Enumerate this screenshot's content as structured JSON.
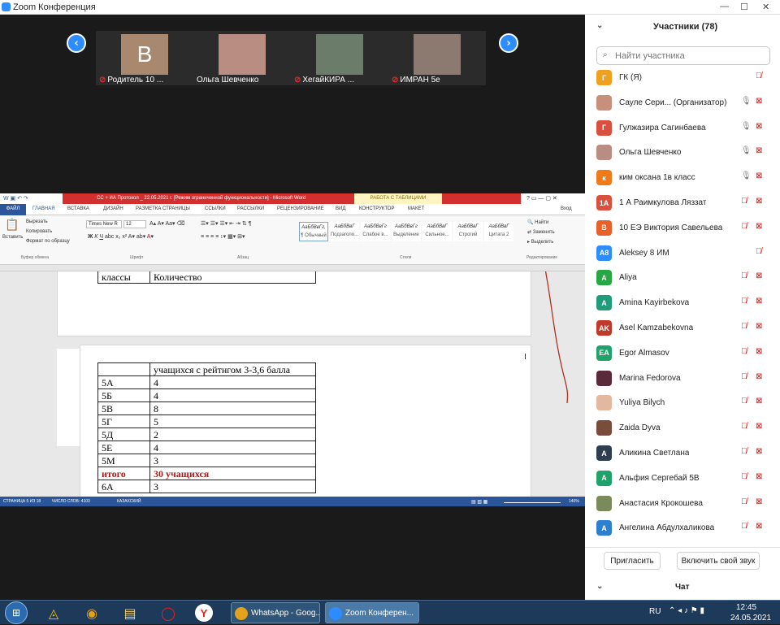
{
  "window": {
    "title": "Zoom Конференция"
  },
  "meeting": {
    "thumbnails": [
      {
        "avatar_letter": "В",
        "avatar_color": "#a8896f",
        "name": "Родитель 10 ...",
        "muted": true
      },
      {
        "avatar_letter": "",
        "avatar_color": "#b98d82",
        "name": "Ольга Шевченко",
        "muted": false
      },
      {
        "avatar_letter": "",
        "avatar_color": "#6b7d6a",
        "name": "ХегайКИРА ...",
        "muted": true
      },
      {
        "avatar_letter": "",
        "avatar_color": "#8c7a70",
        "name": "ИМРАН 5е",
        "muted": true
      }
    ],
    "prev_glyph": "‹",
    "next_glyph": "›"
  },
  "word": {
    "title_text": "СС + ИА Протокол _ 22.05.2021 г. [Режим ограниченной функциональности] - Microsoft Word",
    "context_tab": "РАБОТА С ТАБЛИЦАМИ",
    "signin": "Вход",
    "tabs": [
      "ФАЙЛ",
      "ГЛАВНАЯ",
      "ВСТАВКА",
      "ДИЗАЙН",
      "РАЗМЕТКА СТРАНИЦЫ",
      "ССЫЛКИ",
      "РАССЫЛКИ",
      "РЕЦЕНЗИРОВАНИЕ",
      "ВИД",
      "КОНСТРУКТОР",
      "МАКЕТ"
    ],
    "ribbon": {
      "paste": "Вставить",
      "cut": "Вырезать",
      "copy": "Копировать",
      "format_painter": "Формат по образцу",
      "font_name": "Times New R",
      "font_size": "12",
      "groups": [
        "Буфер обмена",
        "Шрифт",
        "Абзац",
        "Стили",
        "Редактирование"
      ],
      "styles": [
        {
          "sample": "АаБбВвГг,",
          "name": "¶ Обычный"
        },
        {
          "sample": "АаБбВвГ",
          "name": "Подзаголо..."
        },
        {
          "sample": "АаБбВвГг",
          "name": "Слабое в..."
        },
        {
          "sample": "АаБбВвГг",
          "name": "Выделение"
        },
        {
          "sample": "АаБбВвГ",
          "name": "Сильное..."
        },
        {
          "sample": "АаБбВвГ",
          "name": "Строгий"
        },
        {
          "sample": "АаБбВвГ",
          "name": "Цитата 2"
        }
      ],
      "find": "Найти",
      "replace": "Заменить",
      "select": "Выделить"
    },
    "table1": {
      "col1": "классы",
      "col2": "Количество"
    },
    "table2": {
      "header": "учащихся с рейтнгом 3-3,6 балла",
      "rows": [
        {
          "cls": "5А",
          "count": "4"
        },
        {
          "cls": "5Б",
          "count": "4"
        },
        {
          "cls": "5В",
          "count": "8"
        },
        {
          "cls": "5Г",
          "count": "5"
        },
        {
          "cls": "5Д",
          "count": "2"
        },
        {
          "cls": "5Е",
          "count": "4"
        },
        {
          "cls": "5М",
          "count": "3"
        }
      ],
      "total_label": "итого",
      "total_value": "30 учащихся",
      "extra_cls": "6А",
      "extra_count": "3"
    },
    "status": {
      "page": "СТРАНИЦА 5 ИЗ 18",
      "words": "ЧИСЛО СЛОВ: 4103",
      "lang": "КАЗАХСКИЙ",
      "zoom": "140%"
    }
  },
  "participants": {
    "title": "Участники (78)",
    "search_placeholder": "Найти участника",
    "list": [
      {
        "initial": "Г",
        "color": "#f0a020",
        "name": "ГК (Я)",
        "mic": "off",
        "cam": "none"
      },
      {
        "initial": "",
        "color": "#c8907a",
        "name": "Сауле Сери... (Организатор)",
        "mic": "on",
        "cam": "off"
      },
      {
        "initial": "Г",
        "color": "#d9503f",
        "name": "Гулжазира Сагинбаева",
        "mic": "on",
        "cam": "off"
      },
      {
        "initial": "",
        "color": "#b98d82",
        "name": "Ольга Шевченко",
        "mic": "on",
        "cam": "off"
      },
      {
        "initial": "к",
        "color": "#f07a1a",
        "name": "ким оксана 1в класс",
        "mic": "on",
        "cam": "off"
      },
      {
        "initial": "1А",
        "color": "#d9503f",
        "name": "1 А Раимкулова Ляззат",
        "mic": "off",
        "cam": "off"
      },
      {
        "initial": "В",
        "color": "#e8602a",
        "name": "10 ЕЭ Виктория Савельева",
        "mic": "off",
        "cam": "off"
      },
      {
        "initial": "А8",
        "color": "#2d8cff",
        "name": "Aleksey 8 ИМ",
        "mic": "off",
        "cam": "none"
      },
      {
        "initial": "A",
        "color": "#28a745",
        "name": "Aliya",
        "mic": "off",
        "cam": "off"
      },
      {
        "initial": "A",
        "color": "#1f9d7a",
        "name": "Amina Kayirbekova",
        "mic": "off",
        "cam": "off"
      },
      {
        "initial": "AK",
        "color": "#c0392b",
        "name": "Asel Kamzabekovna",
        "mic": "off",
        "cam": "off"
      },
      {
        "initial": "EA",
        "color": "#1fa36a",
        "name": "Egor Almasov",
        "mic": "off",
        "cam": "off"
      },
      {
        "initial": "",
        "color": "#5a2a3a",
        "name": "Marina Fedorova",
        "mic": "off",
        "cam": "off"
      },
      {
        "initial": "",
        "color": "#e4b7a0",
        "name": "Yuliya Bilych",
        "mic": "off",
        "cam": "off"
      },
      {
        "initial": "",
        "color": "#7a4c3a",
        "name": "Zaida Dyva",
        "mic": "off",
        "cam": "off"
      },
      {
        "initial": "А",
        "color": "#2c3e50",
        "name": "Аликина Светлана",
        "mic": "off",
        "cam": "off"
      },
      {
        "initial": "А",
        "color": "#1fa36a",
        "name": "Альфия Сергебай 5В",
        "mic": "off",
        "cam": "off"
      },
      {
        "initial": "",
        "color": "#7b8a5a",
        "name": "Анастасия Крокошева",
        "mic": "off",
        "cam": "off"
      },
      {
        "initial": "А",
        "color": "#2d7fd1",
        "name": "Ангелина Абдулхаликова",
        "mic": "off",
        "cam": "off"
      }
    ],
    "invite": "Пригласить",
    "unmute": "Включить свой звук",
    "chat": "Чат"
  },
  "taskbar": {
    "apps": [
      {
        "label": "WhatsApp - Goog...",
        "color": "#3fa34d"
      },
      {
        "label": "Zoom Конферен...",
        "color": "#2d8cff"
      }
    ],
    "lang": "RU",
    "time": "12:45",
    "date": "24.05.2021"
  }
}
